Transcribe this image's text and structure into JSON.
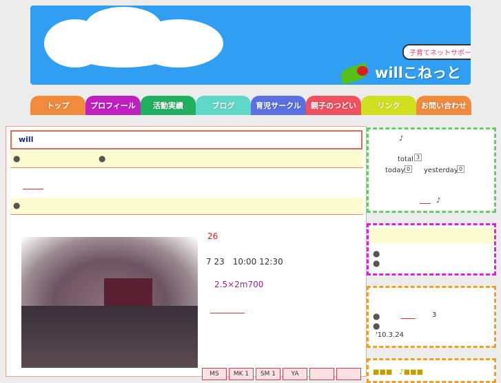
{
  "header": {
    "tagline": "子育てネットサポート",
    "logo": "willこねっと"
  },
  "nav": [
    {
      "label": "トップ",
      "color": "#f08a3c"
    },
    {
      "label": "プロフィール",
      "color": "#c020c0"
    },
    {
      "label": "活動実績",
      "color": "#20b060"
    },
    {
      "label": "ブログ",
      "color": "#60d8c8"
    },
    {
      "label": "育児サークル",
      "color": "#5a70e0"
    },
    {
      "label": "親子のつどい",
      "color": "#f05060"
    },
    {
      "label": "リンク",
      "color": "#d0e020"
    },
    {
      "label": "お問い合わせ",
      "color": "#f08a3c"
    }
  ],
  "main": {
    "title": "will",
    "bullet": "●",
    "event_number": "26",
    "event_time": "7 23　10:00 12:30",
    "event_size": "2.5×2m700",
    "tabs": [
      "MS",
      "MK 1",
      "SM 1",
      "YA",
      "",
      ""
    ]
  },
  "sidebar": {
    "note_mark": "♪",
    "total_label": "total",
    "total_value": "3",
    "today_label": "today",
    "today_value": "0",
    "yesterday_label": "yesterday",
    "yesterday_value": "0",
    "news_count": "3",
    "news_date": "'10.3.24",
    "bottom_marks": "■■■　♪■■■"
  }
}
